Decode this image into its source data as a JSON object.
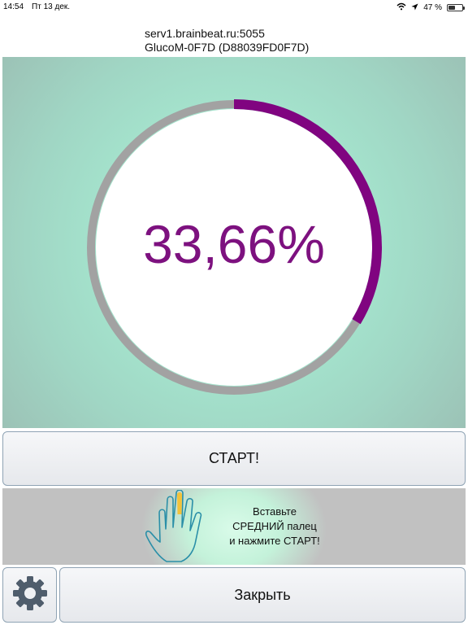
{
  "status_bar": {
    "time": "14:54",
    "date": "Пт 13 дек.",
    "battery_text": "47 %",
    "battery_level": 0.47
  },
  "server": {
    "address": "serv1.brainbeat.ru:5055",
    "device": "GlucoM-0F7D (D88039FD0F7D)"
  },
  "gauge": {
    "value_text": "33,66%",
    "progress": 0.3366,
    "track_color": "#a2a2a2",
    "progress_color": "#800480"
  },
  "buttons": {
    "start_label": "СТАРТ!",
    "close_label": "Закрыть"
  },
  "hint": {
    "line1": "Вставьте",
    "line2": "СРЕДНИЙ палец",
    "line3": "и нажмите СТАРТ!"
  },
  "icons": {
    "settings": "gear-icon",
    "hand": "hand-icon",
    "wifi": "wifi-icon",
    "location": "location-arrow-icon",
    "battery": "battery-icon"
  }
}
